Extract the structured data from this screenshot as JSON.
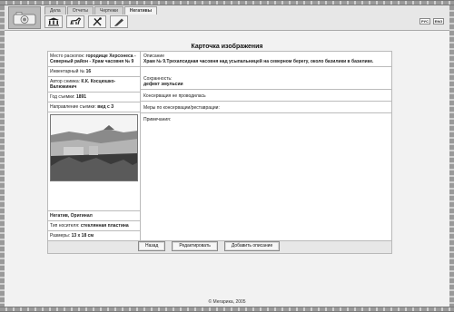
{
  "header": {
    "tabs": [
      "Дела",
      "Отчеты",
      "Чертежи",
      "Негативы"
    ],
    "active_tab": "Негативы",
    "lang": [
      "РУС",
      "ENG"
    ]
  },
  "card": {
    "title": "Карточка изображения",
    "left": {
      "place_label": "Место раскопок:",
      "place_value": "городище Херсонеса - Северный район - Храм часовня № 9",
      "inventory_label": "Инвентарный №",
      "inventory_value": "16",
      "author_label": "Автор снимка:",
      "author_value": "К.К. Косцюшко-Валюжинич",
      "year_label": "Год съемки:",
      "year_value": "1891",
      "direction_label": "Направление съемки:",
      "direction_value": "вид с З",
      "negative_value": "Негатив, Оригинал",
      "carrier_label": "Тип носителя:",
      "carrier_value": "стеклянная пластина",
      "size_label": "Размеры:",
      "size_value": "13 x 18 см"
    },
    "right": {
      "description_label": "Описание",
      "description_value": "Храм № 9.Трехапсидная часовня над усыпальницей на северном берегу, около базилики в базилике.",
      "preservation_label": "Сохранность:",
      "preservation_value": "дефект эмульсии",
      "conservation_value": "Консервация не проводилась",
      "measures_label": "Меры по консервации/реставрации:",
      "notes_label": "Примечания:"
    }
  },
  "buttons": {
    "back": "Назад",
    "edit": "Редактировать",
    "add_description": "Добавить описание"
  },
  "footer": {
    "copyright": "© Мегарика, 2005"
  }
}
